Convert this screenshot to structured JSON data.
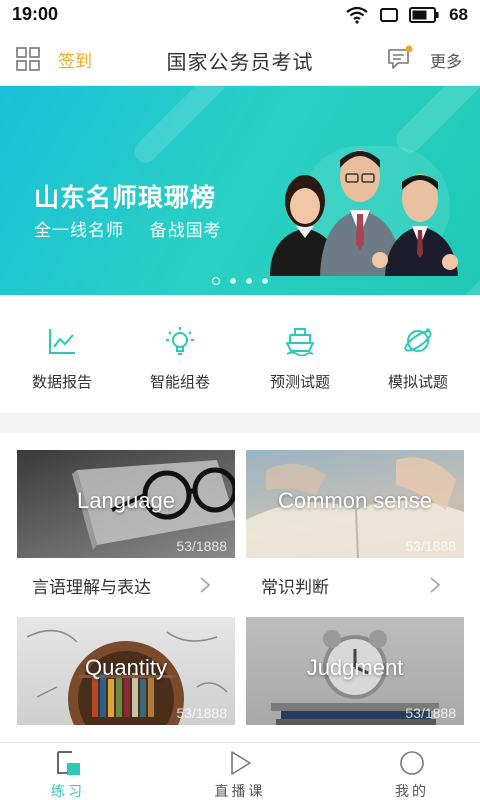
{
  "status_bar": {
    "time": "19:00",
    "battery": "68"
  },
  "nav": {
    "checkin_label": "签到",
    "title": "国家公务员考试",
    "more_label": "更多"
  },
  "banner": {
    "title": "山东名师琅琊榜",
    "subtitle": "全一线名师    备战国考",
    "page_count": 4,
    "active_page": 0
  },
  "quick_actions": [
    {
      "label": "数据报告",
      "icon": "chart-icon"
    },
    {
      "label": "智能组卷",
      "icon": "lightbulb-icon"
    },
    {
      "label": "预测试题",
      "icon": "ship-icon"
    },
    {
      "label": "模拟试题",
      "icon": "planet-icon"
    }
  ],
  "categories": [
    {
      "name_en": "Language",
      "count": "53/1888",
      "label": "言语理解与表达"
    },
    {
      "name_en": "Common sense",
      "count": "53/1888",
      "label": "常识判断"
    },
    {
      "name_en": "Quantity",
      "count": "53/1888"
    },
    {
      "name_en": "Judgment",
      "count": "53/1888"
    }
  ],
  "tabs": [
    {
      "label": "练习",
      "icon": "practice-icon",
      "active": true
    },
    {
      "label": "直播课",
      "icon": "play-icon",
      "active": false
    },
    {
      "label": "我的",
      "icon": "profile-icon",
      "active": false
    }
  ],
  "colors": {
    "accent": "#2cc8b8",
    "checkin": "#f5a623",
    "notification_dot": "#f5a623"
  }
}
